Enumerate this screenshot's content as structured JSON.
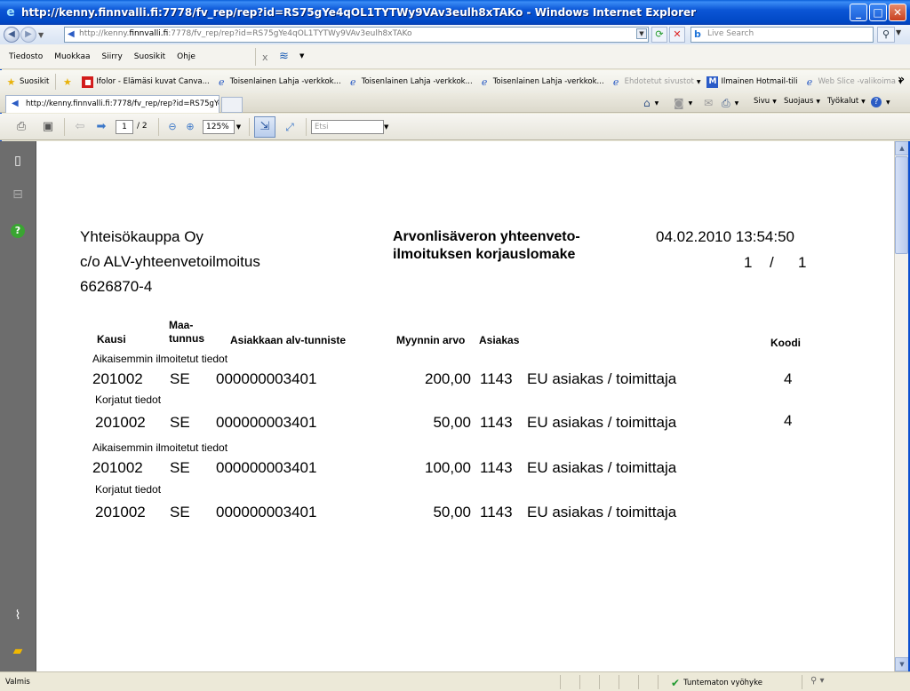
{
  "window": {
    "title": "http://kenny.finnvalli.fi:7778/fv_rep/rep?id=RS75gYe4qOL1TYTWy9VAv3eulh8xTAKo - Windows Internet Explorer"
  },
  "address": {
    "url_prefix": "http://kenny.",
    "url_host": "finnvalli.fi",
    "url_suffix": ":7778/fv_rep/rep?id=RS75gYe4qOL1TYTWy9VAv3eulh8xTAKo",
    "search_placeholder": "Live Search"
  },
  "menu": [
    "Tiedosto",
    "Muokkaa",
    "Siirry",
    "Suosikit",
    "Ohje"
  ],
  "favorites": {
    "suosikit": "Suosikit",
    "items": [
      "Ifolor - Elämäsi kuvat Canva...",
      "Toisenlainen Lahja -verkkok...",
      "Toisenlainen Lahja -verkkok...",
      "Toisenlainen Lahja -verkkok...",
      "Ehdotetut sivustot",
      "Ilmainen Hotmail-tili",
      "Web Slice -valikoima"
    ]
  },
  "tab": {
    "title": "http://kenny.finnvalli.fi:7778/fv_rep/rep?id=RS75gYe..."
  },
  "commands": {
    "sivu": "Sivu",
    "suojaus": "Suojaus",
    "tyokalut": "Työkalut"
  },
  "pdf_toolbar": {
    "page_current": "1",
    "page_total": "/ 2",
    "zoom": "125%",
    "find_placeholder": "Etsi"
  },
  "report": {
    "company": [
      "Yhteisökauppa Oy",
      "c/o ALV-yhteenvetoilmoitus",
      "6626870-4"
    ],
    "title_line1": "Arvonlisäveron yhteenveto-",
    "title_line2": "ilmoituksen korjauslomake",
    "datetime": "04.02.2010 13:54:50",
    "page_num": "1",
    "page_slash": "/",
    "page_of": "1",
    "headers": {
      "kausi": "Kausi",
      "maa_line1": "Maa-",
      "maa_line2": "tunnus",
      "alv": "Asiakkaan alv-tunniste",
      "myynnin": "Myynnin arvo",
      "asiakas": "Asiakas",
      "koodi": "Koodi"
    },
    "rows": [
      {
        "label": "Aikaisemmin ilmoitetut tiedot",
        "kausi": "201002",
        "maa": "SE",
        "alv": "000000003401",
        "arvo": "200,00",
        "asiakas_nro": "1143",
        "asiakas": "EU asiakas / toimittaja",
        "koodi": "4"
      },
      {
        "label": "Korjatut tiedot",
        "kausi": "201002",
        "maa": "SE",
        "alv": "000000003401",
        "arvo": "50,00",
        "asiakas_nro": "1143",
        "asiakas": "EU asiakas / toimittaja",
        "koodi": "4"
      },
      {
        "label": "Aikaisemmin ilmoitetut tiedot",
        "kausi": "201002",
        "maa": "SE",
        "alv": "000000003401",
        "arvo": "100,00",
        "asiakas_nro": "1143",
        "asiakas": "EU asiakas / toimittaja",
        "koodi": ""
      },
      {
        "label": "Korjatut tiedot",
        "kausi": "201002",
        "maa": "SE",
        "alv": "000000003401",
        "arvo": "50,00",
        "asiakas_nro": "1143",
        "asiakas": "EU asiakas / toimittaja",
        "koodi": ""
      }
    ]
  },
  "status": {
    "text": "Valmis",
    "zone": "Tuntematon vyöhyke"
  },
  "colors": {
    "titlebar": "#0b56d6",
    "sidenav": "#6d6d6d",
    "check": "#1f9a2f"
  }
}
